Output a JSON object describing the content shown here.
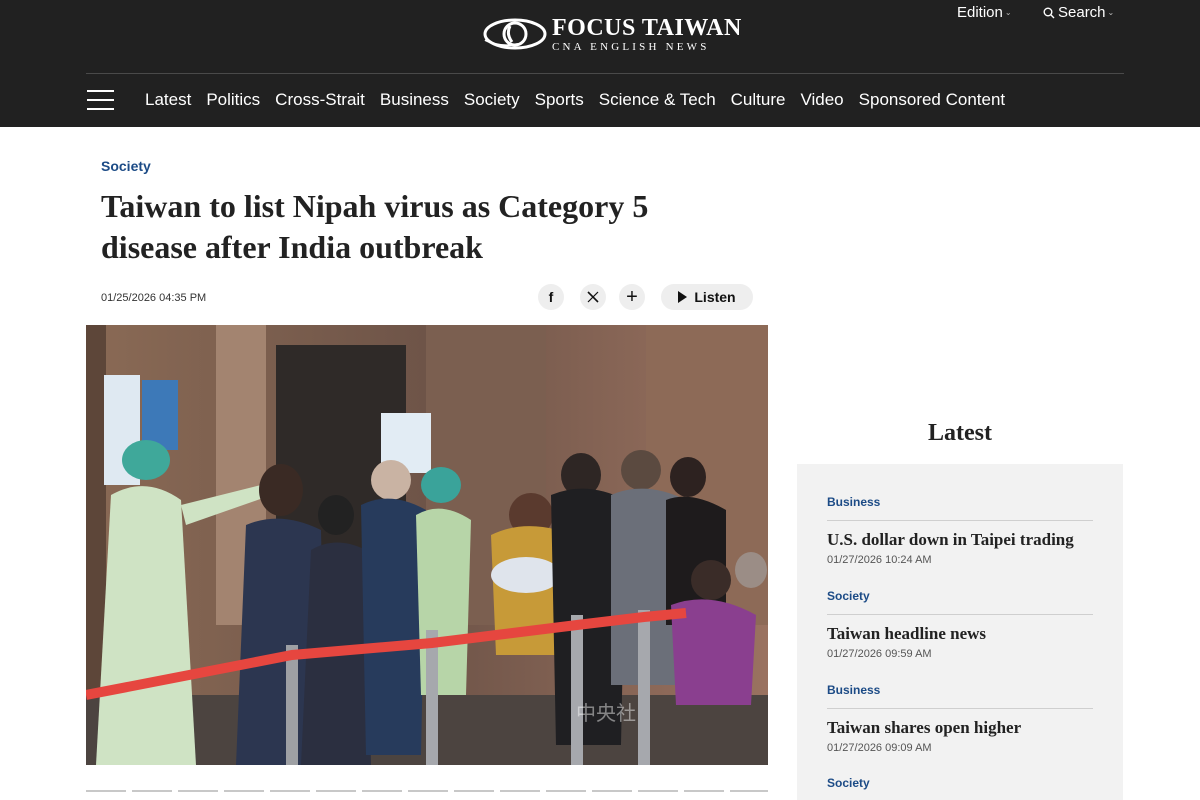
{
  "header": {
    "logo_title": "FOCUS TAIWAN",
    "logo_subtitle": "CNA ENGLISH NEWS",
    "edition_label": "Edition",
    "search_label": "Search",
    "nav": [
      "Latest",
      "Politics",
      "Cross-Strait",
      "Business",
      "Society",
      "Sports",
      "Science & Tech",
      "Culture",
      "Video",
      "Sponsored Content"
    ]
  },
  "article": {
    "category": "Society",
    "headline": "Taiwan to list Nipah virus as Category 5 disease after India outbreak",
    "date": "01/25/2026 04:35 PM",
    "share_icons": [
      "facebook-icon",
      "x-icon",
      "plus-icon"
    ],
    "listen_label": "Listen",
    "photo_watermark": "中央社"
  },
  "sidebar": {
    "latest_title": "Latest",
    "items": [
      {
        "category": "Business",
        "title": "U.S. dollar down in Taipei trading",
        "date": "01/27/2026 10:24 AM"
      },
      {
        "category": "Society",
        "title": "Taiwan headline news",
        "date": "01/27/2026 09:59 AM"
      },
      {
        "category": "Business",
        "title": "Taiwan shares open higher",
        "date": "01/27/2026 09:09 AM"
      },
      {
        "category": "Society",
        "title": "",
        "date": ""
      }
    ]
  },
  "colors": {
    "header_bg": "#212121",
    "accent_blue": "#1c4b86",
    "sidebar_bg": "#f2f2f2"
  }
}
